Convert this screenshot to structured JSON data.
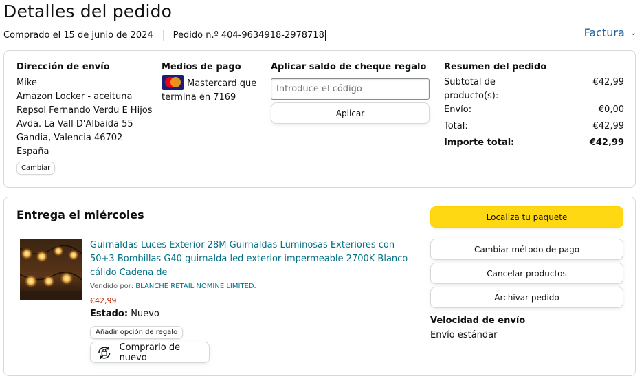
{
  "header": {
    "title": "Detalles del pedido",
    "ordered_on": "Comprado el 15 de junio de 2024",
    "order_number": "Pedido n.º 404-9634918-2978718",
    "invoice": "Factura"
  },
  "shipping": {
    "heading": "Dirección de envío",
    "lines": [
      "Mike",
      "Amazon Locker - aceituna",
      "Repsol Fernando Verdu E Hijos",
      "Avda. La Vall D'Albaida 55",
      "Gandia, Valencia 46702",
      "España"
    ],
    "change_label": "Cambiar"
  },
  "payment": {
    "heading": "Medios de pago",
    "card_text": "Mastercard que termina en 7169",
    "card_icon": "mastercard-logo"
  },
  "gift_card": {
    "heading": "Aplicar saldo de cheque regalo",
    "placeholder": "Introduce el código",
    "apply_label": "Aplicar"
  },
  "summary": {
    "heading": "Resumen del pedido",
    "rows": [
      {
        "label": "Subtotal de producto(s):",
        "value": "€42,99"
      },
      {
        "label": "Envío:",
        "value": "€0,00"
      },
      {
        "label": "Total:",
        "value": "€42,99"
      }
    ],
    "grand_total_label": "Importe total:",
    "grand_total_value": "€42,99"
  },
  "delivery": {
    "title": "Entrega el miércoles",
    "product": {
      "title": "Guirnaldas Luces Exterior 28M Guirnaldas Luminosas Exteriores con 50+3 Bombillas G40 guirnalda led exterior impermeable 2700K Blanco cálido Cadena de",
      "sold_by_label": "Vendido por:",
      "seller": "BLANCHE RETAIL NOMINE LIMITED.",
      "price": "€42,99",
      "condition_label": "Estado:",
      "condition_value": "Nuevo",
      "gift_option_label": "Añadir opción de regalo",
      "buy_again_label": "Comprarlo de nuevo"
    },
    "actions": {
      "track": "Localiza tu paquete",
      "change_payment": "Cambiar método de pago",
      "cancel": "Cancelar productos",
      "archive": "Archivar pedido"
    },
    "speed_heading": "Velocidad de envío",
    "speed_value": "Envío estándar"
  },
  "colors": {
    "link": "#007185",
    "accent_yellow": "#ffd814",
    "price_red": "#b12704",
    "invoice_blue": "#2162a1"
  }
}
